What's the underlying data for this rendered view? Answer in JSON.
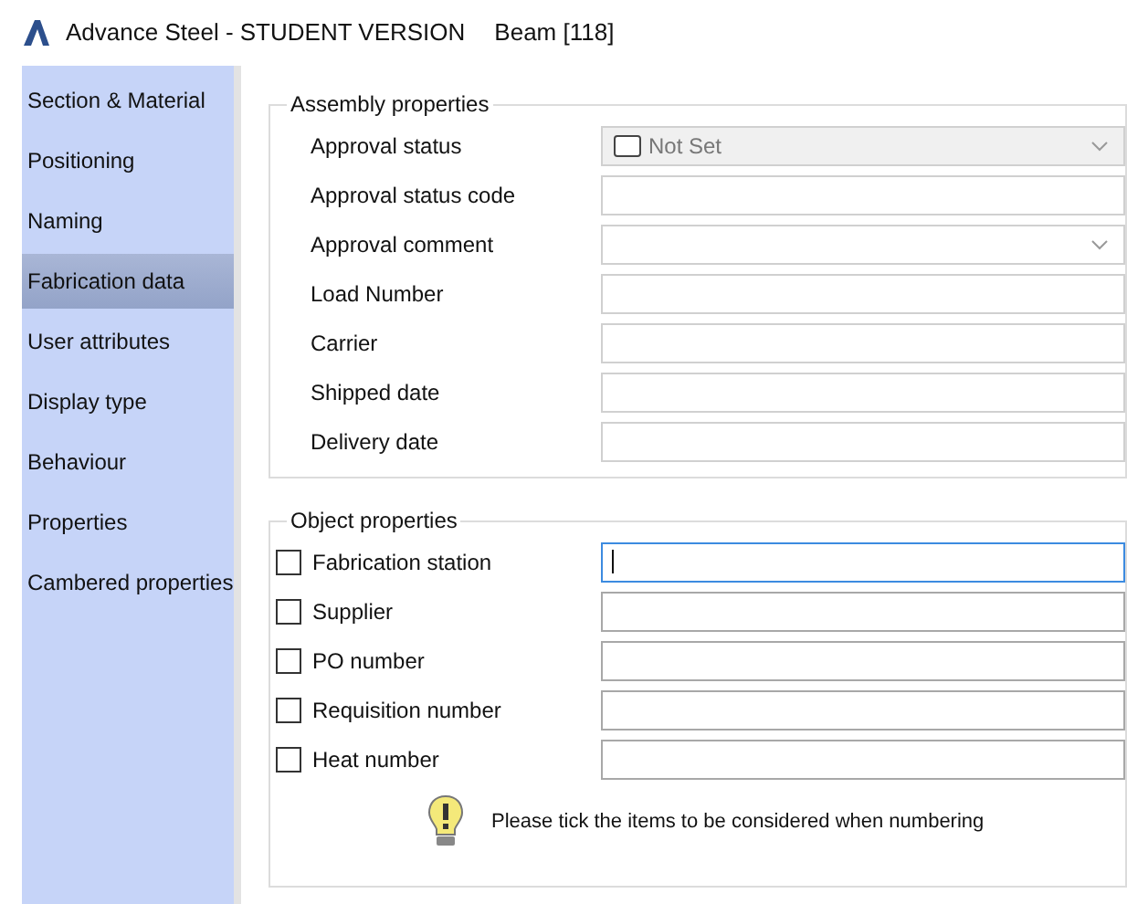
{
  "window": {
    "title": "Advance Steel - STUDENT VERSION",
    "subtitle": "Beam [118]"
  },
  "sidebar": {
    "items": [
      {
        "label": "Section & Material",
        "selected": false
      },
      {
        "label": "Positioning",
        "selected": false
      },
      {
        "label": "Naming",
        "selected": false
      },
      {
        "label": "Fabrication data",
        "selected": true
      },
      {
        "label": "User attributes",
        "selected": false
      },
      {
        "label": "Display type",
        "selected": false
      },
      {
        "label": "Behaviour",
        "selected": false
      },
      {
        "label": "Properties",
        "selected": false
      },
      {
        "label": "Cambered properties",
        "selected": false
      }
    ]
  },
  "assembly": {
    "title": "Assembly properties",
    "fields": [
      {
        "label": "Approval status",
        "kind": "combo",
        "value": "Not Set",
        "disabled": true
      },
      {
        "label": "Approval status code",
        "kind": "text",
        "disabled": false
      },
      {
        "label": "Approval comment",
        "kind": "combo",
        "disabled": false
      },
      {
        "label": "Load Number",
        "kind": "text",
        "disabled": false
      },
      {
        "label": "Carrier",
        "kind": "text",
        "disabled": false
      },
      {
        "label": "Shipped date",
        "kind": "text",
        "disabled": false
      },
      {
        "label": "Delivery date",
        "kind": "text",
        "disabled": false
      }
    ]
  },
  "object": {
    "title": "Object properties",
    "fields": [
      {
        "label": "Fabrication station",
        "checked": false,
        "focused": true
      },
      {
        "label": "Supplier",
        "checked": false,
        "focused": false
      },
      {
        "label": "PO number",
        "checked": false,
        "focused": false
      },
      {
        "label": "Requisition number",
        "checked": false,
        "focused": false
      },
      {
        "label": "Heat number",
        "checked": false,
        "focused": false
      }
    ],
    "hint": "Please tick the items to be considered when numbering"
  }
}
